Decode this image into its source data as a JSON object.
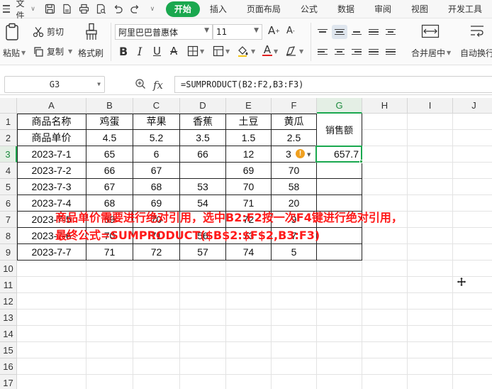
{
  "menu": {
    "file_label": "文件",
    "tabs": [
      {
        "label": "开始",
        "active": true
      },
      {
        "label": "插入"
      },
      {
        "label": "页面布局"
      },
      {
        "label": "公式"
      },
      {
        "label": "数据"
      },
      {
        "label": "审阅"
      },
      {
        "label": "视图"
      },
      {
        "label": "开发工具"
      }
    ]
  },
  "ribbon": {
    "paste_label": "粘贴",
    "cut_label": "剪切",
    "copy_label": "复制",
    "format_painter_label": "格式刷",
    "font_name": "阿里巴巴普惠体",
    "font_size": "11",
    "merge_label": "合并居中",
    "wrap_label": "自动换行"
  },
  "formula_bar": {
    "name_box": "G3",
    "fx_label": "fx",
    "formula": "=SUMPRODUCT(B2:F2,B3:F3)"
  },
  "sheet": {
    "columns": [
      "A",
      "B",
      "C",
      "D",
      "E",
      "F",
      "G",
      "H",
      "I",
      "J"
    ],
    "rows": [
      "1",
      "2",
      "3",
      "4",
      "5",
      "6",
      "7",
      "8",
      "9",
      "10",
      "11",
      "12",
      "13",
      "14",
      "15",
      "16",
      "17"
    ],
    "selected_column": "G",
    "selected_row": "3",
    "cells": {
      "A1": "商品名称",
      "B1": "鸡蛋",
      "C1": "苹果",
      "D1": "香蕉",
      "E1": "土豆",
      "F1": "黄瓜",
      "G1": "销售额",
      "A2": "商品单价",
      "B2": "4.5",
      "C2": "5.2",
      "D2": "3.5",
      "E2": "1.5",
      "F2": "2.5",
      "A3": "2023-7-1",
      "B3": "65",
      "C3": "6",
      "D3": "66",
      "E3": "12",
      "F3": "3",
      "G3": "657.7",
      "A4": "2023-7-2",
      "B4": "66",
      "C4": "67",
      "D4": "",
      "E4": "69",
      "F4": "70",
      "A5": "2023-7-3",
      "B5": "67",
      "C5": "68",
      "D5": "53",
      "E5": "70",
      "F5": "58",
      "A6": "2023-7-4",
      "B6": "68",
      "C6": "69",
      "D6": "54",
      "E6": "71",
      "F6": "20",
      "A7": "2023-7-5",
      "B7": "69",
      "C7": "70",
      "D7": "",
      "E7": "72",
      "F7": "9",
      "A8": "2023-7-6",
      "B8": "70",
      "C8": "71",
      "D8": "56",
      "E8": "73",
      "F8": "7",
      "A9": "2023-7-7",
      "B9": "71",
      "C9": "72",
      "D9": "57",
      "E9": "74",
      "F9": "5"
    }
  },
  "annotation": {
    "line1": "商品单价需要进行绝对引用，选中B2:F2按一次F4键进行绝对引用，",
    "line2": "最终公式=SUMPRODUCT($B$2:$F$2,B3:F3)",
    "color": "#ff1a1a"
  },
  "colors": {
    "accent": "#1aa84f",
    "warning": "#f0a020"
  }
}
